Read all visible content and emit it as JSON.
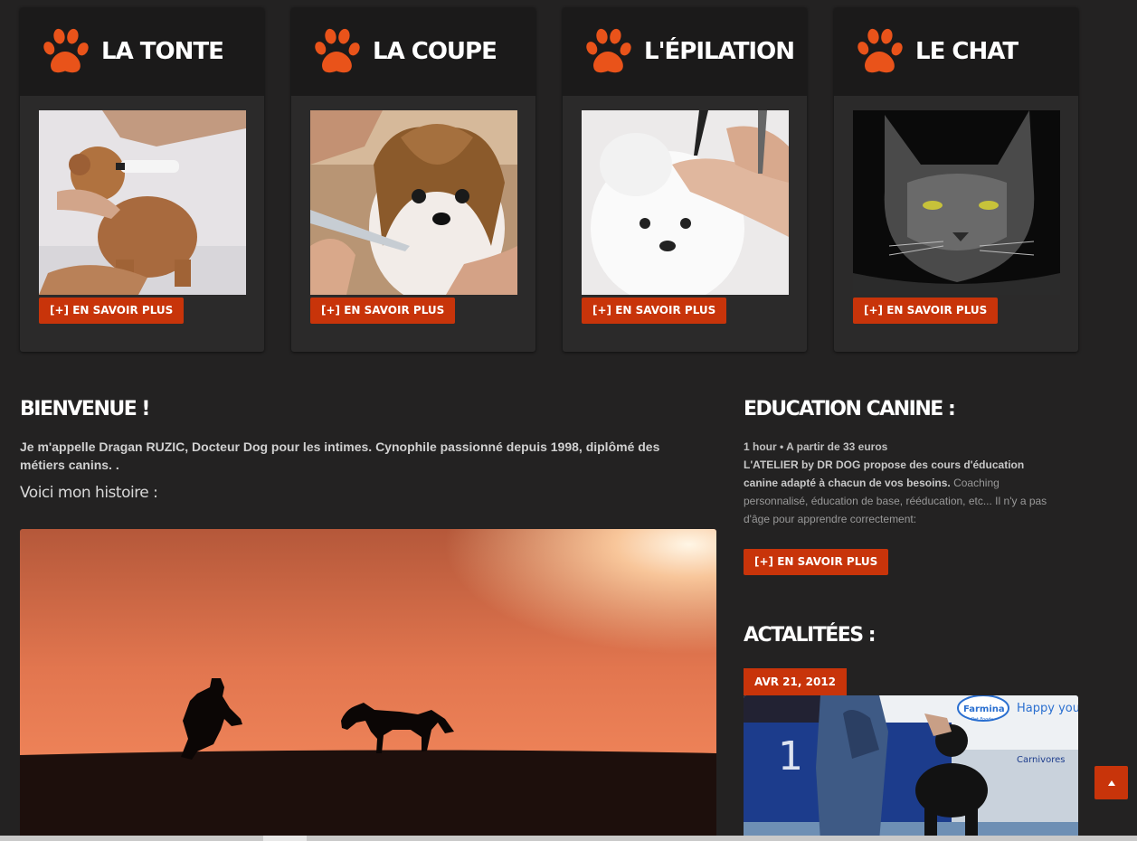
{
  "services": [
    {
      "title": "LA TONTE",
      "button": "[+] EN SAVOIR PLUS",
      "image": "poodle-grooming-photo",
      "icon": "paw-icon"
    },
    {
      "title": "LA COUPE",
      "button": "[+] EN SAVOIR PLUS",
      "image": "shih-tzu-scissors-photo",
      "icon": "paw-icon"
    },
    {
      "title": "L'ÉPILATION",
      "button": "[+] EN SAVOIR PLUS",
      "image": "white-dog-grooming-photo",
      "icon": "paw-icon"
    },
    {
      "title": "LE CHAT",
      "button": "[+] EN SAVOIR PLUS",
      "image": "grey-cat-photo",
      "icon": "paw-icon"
    }
  ],
  "welcome": {
    "title": "BIENVENUE !",
    "text": "Je m'appelle Dragan RUZIC, Docteur Dog pour les intimes. Cynophile passionné depuis 1998, diplômé des métiers canins. .",
    "story_label": "Voici mon histoire :",
    "image": "sunset-dog-silhouette-photo"
  },
  "education": {
    "title": "EDUCATION CANINE :",
    "meta": "1 hour • A partir de 33 euros",
    "body_bold": "L'ATELIER by DR DOG propose des cours d'éducation canine adapté à chacun de vos besoins.",
    "body_rest": " Coaching personnalisé, éducation de base, rééducation, etc... Il n'y a pas d'âge pour apprendre correctement:",
    "button": "[+] EN SAVOIR PLUS"
  },
  "news": {
    "title": "ACTALITÉES :",
    "date": "AVR 21, 2012",
    "image": "dog-show-photo",
    "image_sign_text": "Farmina",
    "image_sign_sub": "Pet Foods",
    "image_banner": "Happy you",
    "image_number": "1",
    "image_sign2": "Carnivores"
  },
  "colors": {
    "accent": "#c8340a",
    "background": "#232222",
    "card": "#2b2a2a",
    "card_header": "#1b1a1a"
  },
  "back_to_top_icon": "caret-up-icon"
}
